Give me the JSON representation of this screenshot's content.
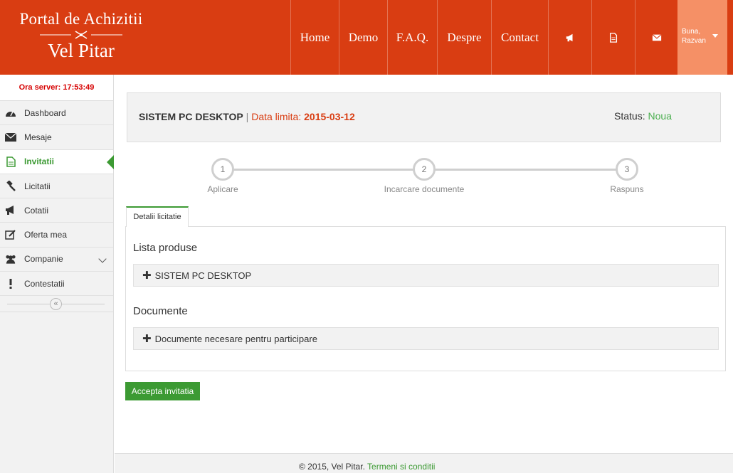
{
  "header": {
    "logo_line1": "Portal de Achizitii",
    "logo_line2": "Vel Pitar",
    "nav": [
      {
        "label": "Home"
      },
      {
        "label": "Demo"
      },
      {
        "label": "F.A.Q."
      },
      {
        "label": "Despre"
      },
      {
        "label": "Contact"
      }
    ],
    "icons": [
      "megaphone-icon",
      "document-icon",
      "envelope-icon"
    ],
    "user_greeting": "Buna,",
    "user_name": "Razvan"
  },
  "sidebar": {
    "server_time": "Ora server: 17:53:49",
    "items": [
      {
        "label": "Dashboard",
        "icon": "dashboard-icon"
      },
      {
        "label": "Mesaje",
        "icon": "envelope-icon"
      },
      {
        "label": "Invitatii",
        "icon": "document-icon",
        "active": true
      },
      {
        "label": "Licitatii",
        "icon": "gavel-icon"
      },
      {
        "label": "Cotatii",
        "icon": "megaphone-icon"
      },
      {
        "label": "Oferta mea",
        "icon": "edit-icon"
      },
      {
        "label": "Companie",
        "icon": "users-icon"
      },
      {
        "label": "Contestatii",
        "icon": "exclamation-icon"
      }
    ],
    "collapse_glyph": "«"
  },
  "title_box": {
    "product": "SISTEM PC DESKTOP",
    "separator": "|",
    "deadline_label": "Data limita:",
    "deadline_value": "2015-03-12",
    "status_label": "Status:",
    "status_value": "Noua"
  },
  "steps": [
    {
      "number": "1",
      "label": "Aplicare"
    },
    {
      "number": "2",
      "label": "Incarcare documente"
    },
    {
      "number": "3",
      "label": "Raspuns"
    }
  ],
  "tab_label": "Detalii licitatie",
  "panel": {
    "products_title": "Lista produse",
    "product_row": "SISTEM PC DESKTOP",
    "documents_title": "Documente",
    "documents_row": "Documente necesare pentru participare",
    "plus_glyph": "✚"
  },
  "accept_button": "Accepta invitatia",
  "footer": {
    "copyright": "© 2015, Vel Pitar.",
    "link": "Termeni si conditii"
  },
  "colors": {
    "brand": "#d93d12",
    "accent": "#3c9a33",
    "user_box": "#f59066",
    "server_time": "#d60000"
  }
}
